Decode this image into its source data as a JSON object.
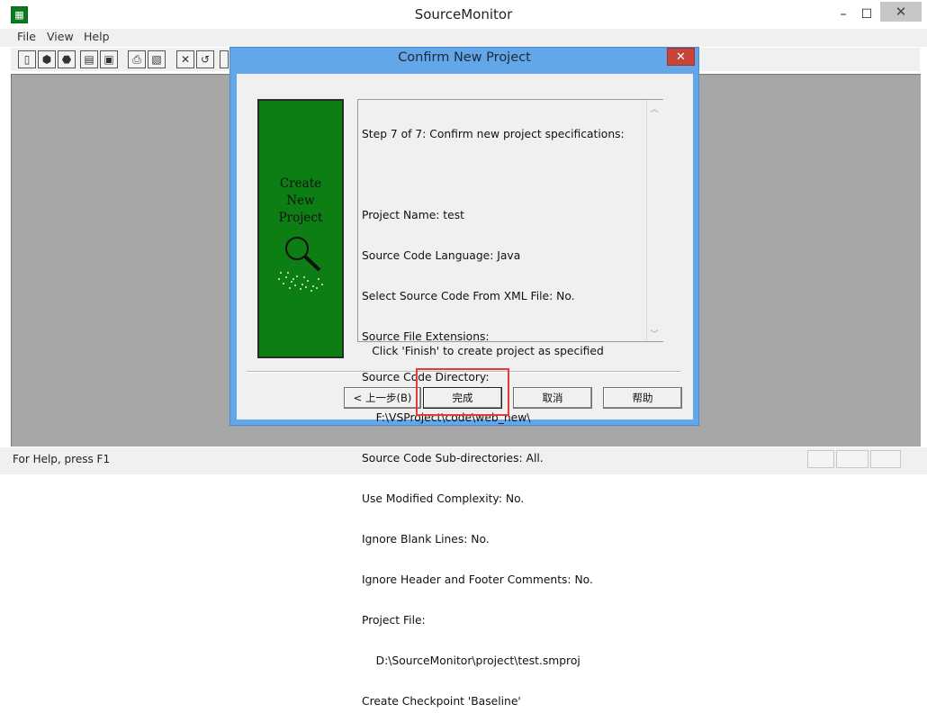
{
  "window": {
    "title": "SourceMonitor",
    "minimize": "–",
    "maximize": "☐",
    "close": "✕",
    "icon": "app-icon"
  },
  "menu": [
    "File",
    "View",
    "Help"
  ],
  "toolbar": {
    "icons": [
      "new-icon",
      "open-icon",
      "open-folder-icon",
      "save-icon",
      "print-icon",
      "preview-icon",
      "delete-icon",
      "refresh-icon"
    ]
  },
  "status": {
    "help": "For Help, press F1"
  },
  "dialog": {
    "title": "Confirm New Project",
    "close": "✕",
    "panel_text": [
      "Create",
      "New",
      "Project"
    ],
    "panel_icon": "magnifier-icon",
    "spec_lines": [
      "Step 7 of 7: Confirm new project specifications:",
      "",
      "Project Name: test",
      "Source Code Language: Java",
      "Select Source Code From XML File: No.",
      "Source File Extensions:",
      "Source Code Directory:",
      "    F:\\VSProject\\code\\web_new\\",
      "Source Code Sub-directories: All.",
      "Use Modified Complexity: No.",
      "Ignore Blank Lines: No.",
      "Ignore Header and Footer Comments: No.",
      "Project File:",
      "    D:\\SourceMonitor\\project\\test.smproj",
      "Create Checkpoint 'Baseline'"
    ],
    "hint": "Click 'Finish' to create project as specified",
    "buttons": {
      "back": "< 上一步(B)",
      "finish": "完成",
      "cancel": "取消",
      "help": "帮助"
    },
    "highlight_color": "#e33c3c"
  },
  "colors": {
    "dialog_frame": "#63a7e9",
    "panel_green": "#0c7e14",
    "workspace": "#a7a7a7"
  }
}
